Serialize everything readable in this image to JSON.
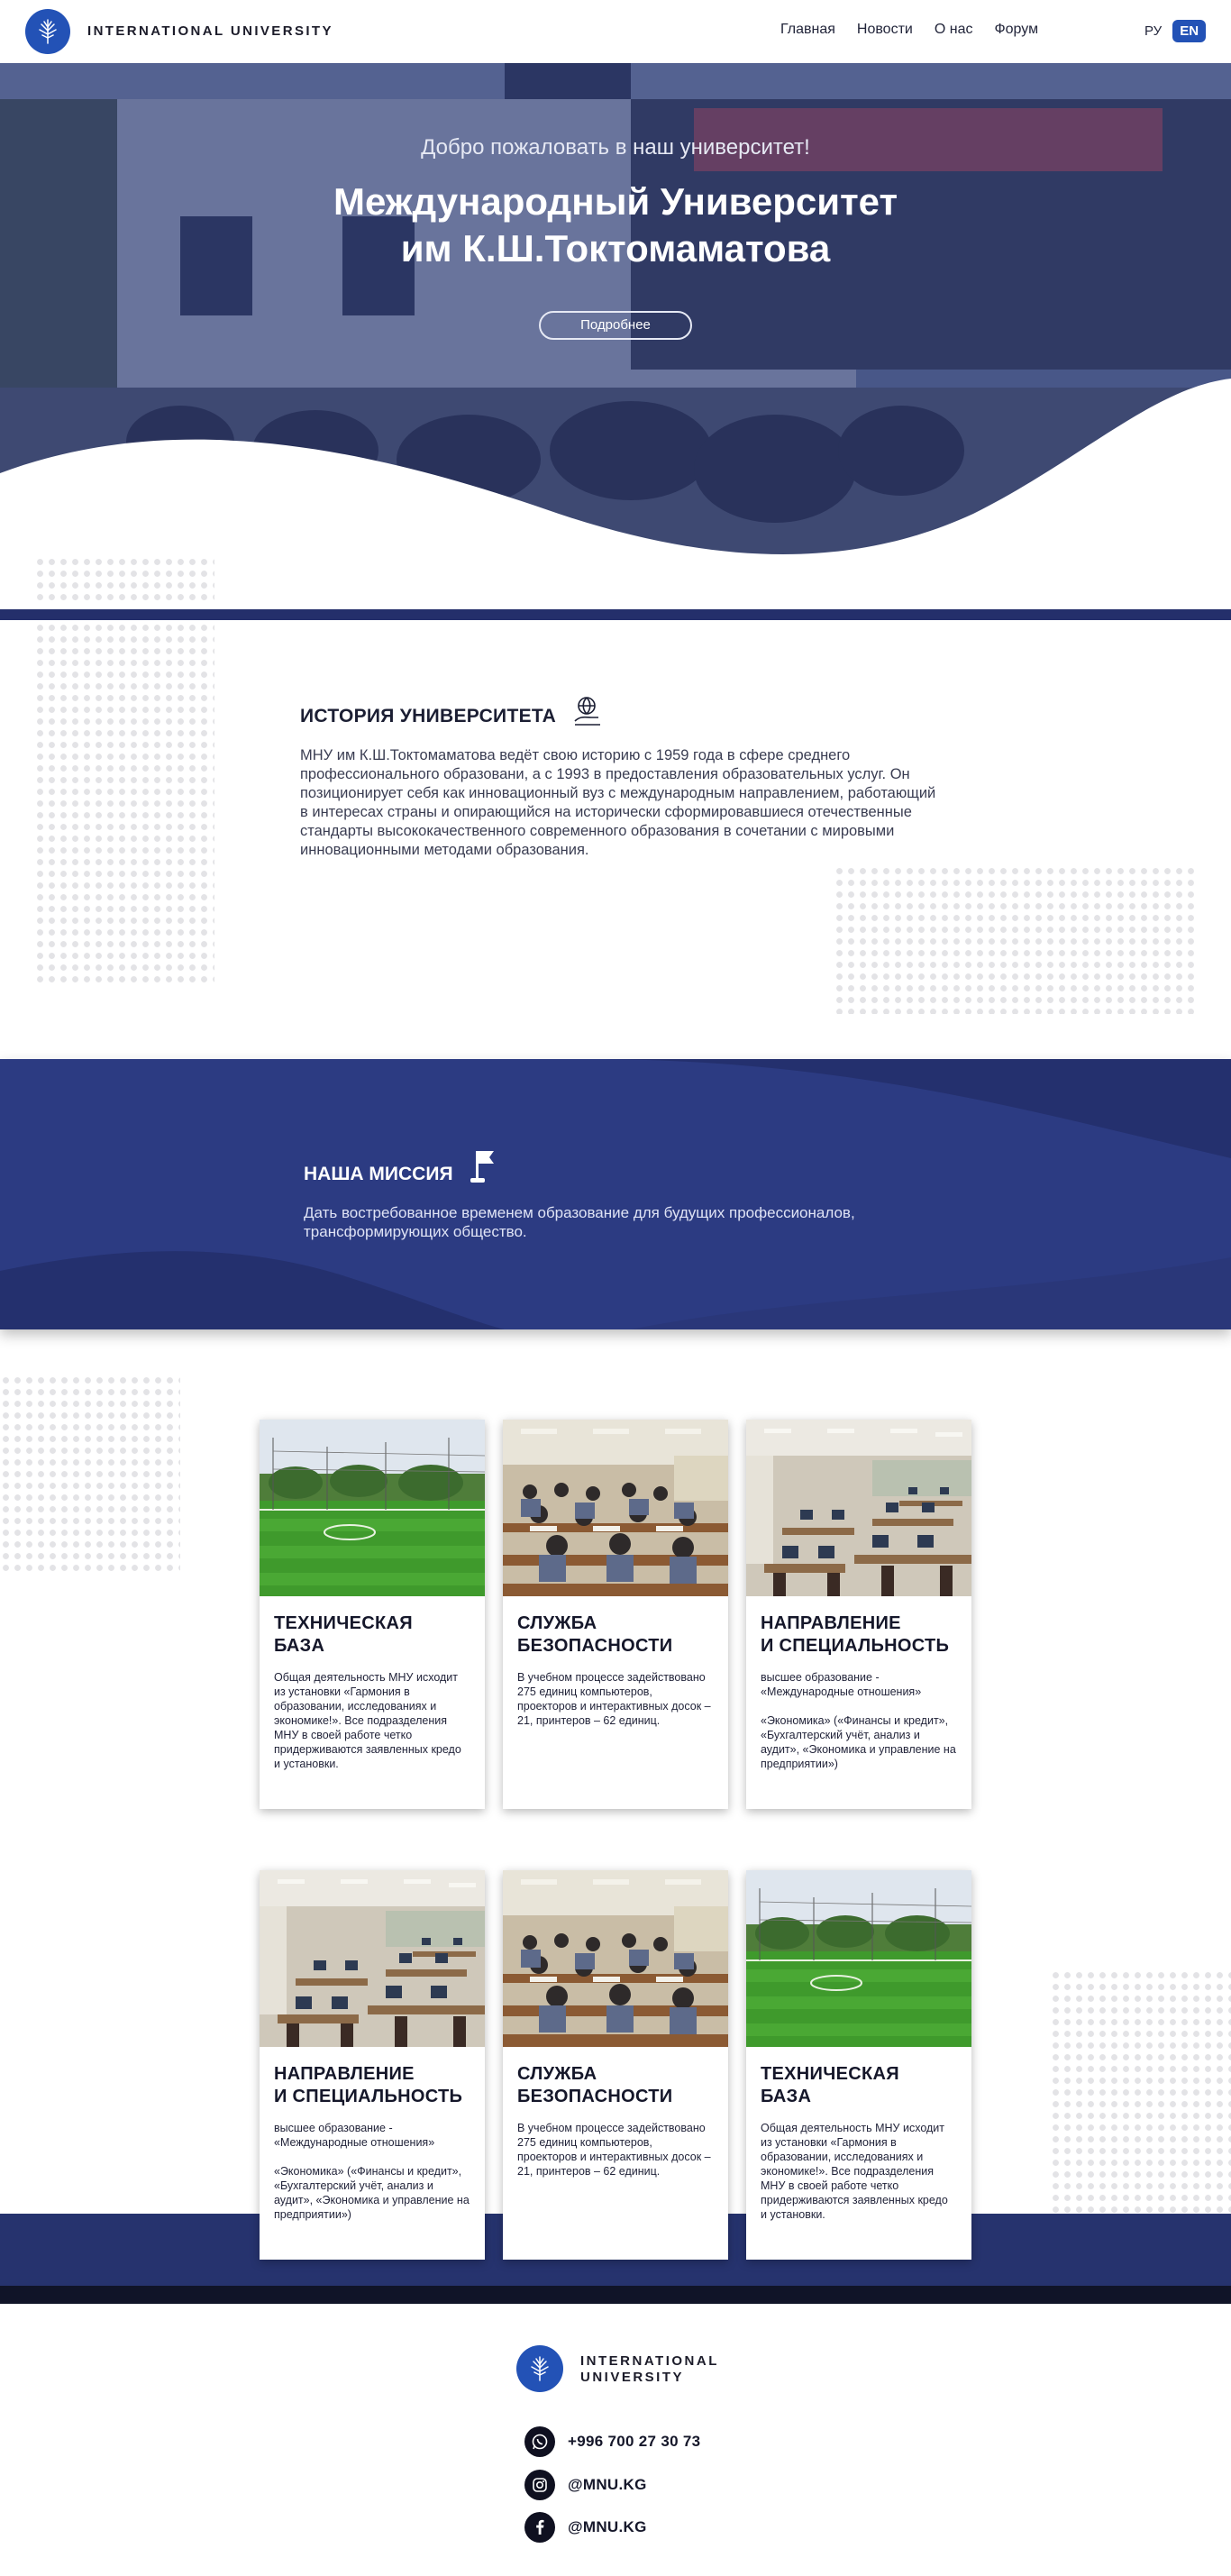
{
  "header": {
    "logo_text": "INTERNATIONAL UNIVERSITY",
    "nav": [
      "Главная",
      "Новости",
      "О нас",
      "Форум"
    ],
    "lang_ru": "РУ",
    "lang_en": "EN"
  },
  "hero": {
    "subtitle": "Добро пожаловать в наш университет!",
    "title_line1": "Международный Университет",
    "title_line2": "им К.Ш.Токтомаматова",
    "button": "Подробнее"
  },
  "history": {
    "title": "ИСТОРИЯ УНИВЕРСИТЕТА",
    "text": "МНУ им К.Ш.Токтомаматова ведёт свою историю с 1959 года в сфере среднего профессионального образовани, а с 1993 в предоставления образовательных услуг. Он позиционирует себя как инновационный вуз с международным направлением, работающий в интересах страны и опирающийся на исторически сформировавшиеся отечественные стандарты высококачественного современного образования в сочетании с мировыми инновационными методами образования."
  },
  "mission": {
    "title": "НАША МИССИЯ",
    "text": "Дать востребованное временем образование для будущих профессионалов, трансформирующих общество."
  },
  "cards": [
    {
      "title_l1": "ТЕХНИЧЕСКАЯ",
      "title_l2": "БАЗА",
      "text": "Общая деятельность МНУ исходит из установки «Гармония в образовании, исследованиях и экономике!». Все подразделения МНУ в своей работе четко придерживаются заявленных кредо и установки.",
      "image": "football-field"
    },
    {
      "title_l1": "СЛУЖБА",
      "title_l2": "БЕЗОПАСНОСТИ",
      "text": "В учебном процессе задействовано 275 единиц компьютеров, проекторов и интерактивных досок – 21, принтеров – 62 единиц.",
      "image": "exam-hall"
    },
    {
      "title_l1": "НАПРАВЛЕНИЕ",
      "title_l2": "И СПЕЦИАЛЬНОСТЬ",
      "text": "высшее образование - «Международные отношения»\n\n«Экономика» («Финансы и кредит», «Бухгалтерский учёт, анализ и аудит», «Экономика и управление на предприятии»)",
      "image": "computer-lab"
    },
    {
      "title_l1": "НАПРАВЛЕНИЕ",
      "title_l2": "И СПЕЦИАЛЬНОСТЬ",
      "text": "высшее образование - «Международные отношения»\n\n«Экономика» («Финансы и кредит», «Бухгалтерский учёт, анализ и аудит», «Экономика и управление на предприятии»)",
      "image": "computer-lab"
    },
    {
      "title_l1": "СЛУЖБА",
      "title_l2": "БЕЗОПАСНОСТИ",
      "text": "В учебном процессе задействовано 275 единиц компьютеров, проекторов и интерактивных досок – 21, принтеров – 62 единиц.",
      "image": "exam-hall"
    },
    {
      "title_l1": "ТЕХНИЧЕСКАЯ",
      "title_l2": "БАЗА",
      "text": "Общая деятельность МНУ исходит из установки «Гармония в образовании, исследованиях и экономике!». Все подразделения МНУ в своей работе четко придерживаются заявленных кредо и установки.",
      "image": "football-field"
    }
  ],
  "footer": {
    "logo_line1": "INTERNATIONAL",
    "logo_line2": "UNIVERSITY",
    "phone": "+996 700 27 30 73",
    "instagram": "@MNU.KG",
    "facebook": "@MNU.KG"
  },
  "colors": {
    "accent": "#2352b6",
    "navy": "#26336e",
    "mission_bg": "#2b3a80"
  }
}
